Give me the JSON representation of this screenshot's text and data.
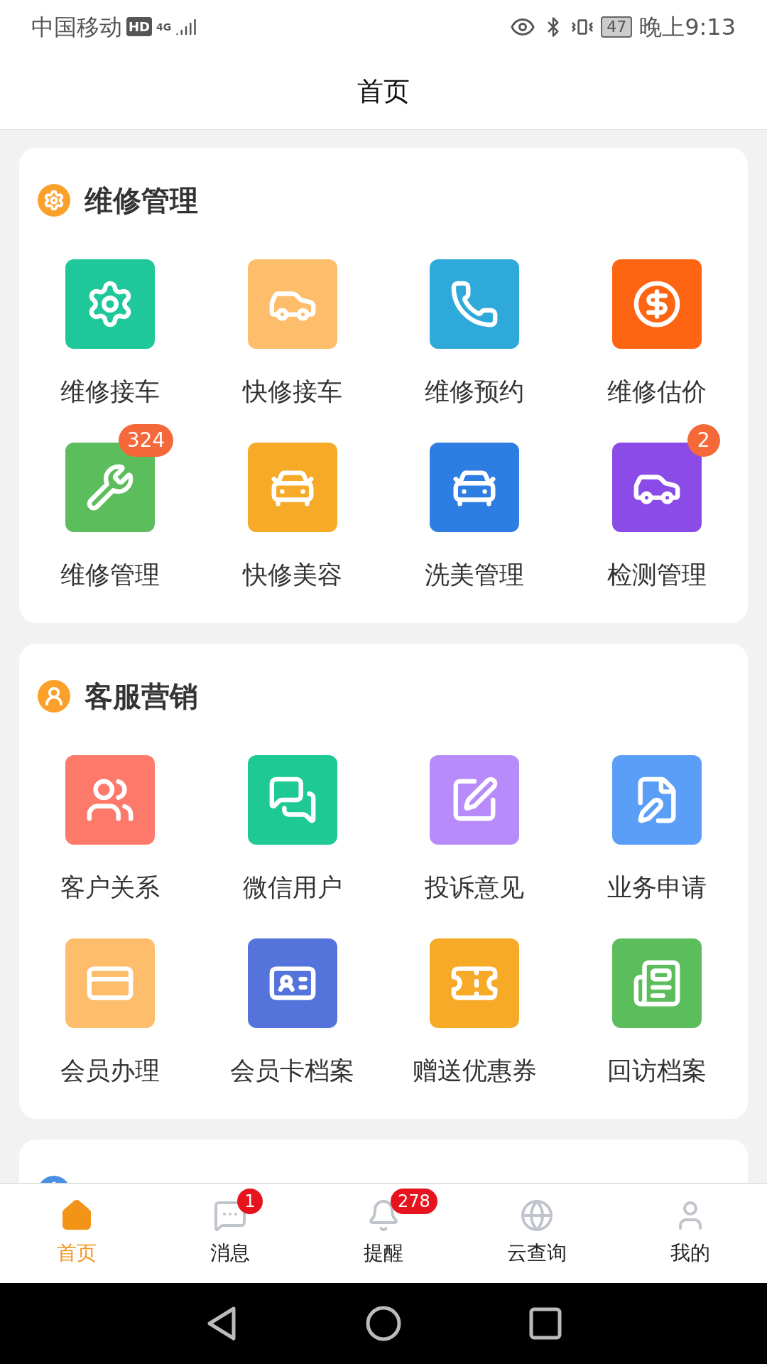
{
  "status_bar": {
    "carrier": "中国移动",
    "hd": "HD",
    "network": "4G",
    "battery": "47",
    "time": "晚上9:13"
  },
  "header": {
    "title": "首页"
  },
  "sections": [
    {
      "title": "维修管理",
      "color": "#fba02a",
      "items": [
        {
          "label": "维修接车",
          "color": "#1ec89a"
        },
        {
          "label": "快修接车",
          "color": "#fdbd6a"
        },
        {
          "label": "维修预约",
          "color": "#2fa9d9"
        },
        {
          "label": "维修估价",
          "color": "#fe6512"
        },
        {
          "label": "维修管理",
          "color": "#5cbd5c",
          "badge": "324"
        },
        {
          "label": "快修美容",
          "color": "#f7a928"
        },
        {
          "label": "洗美管理",
          "color": "#2e7de2"
        },
        {
          "label": "检测管理",
          "color": "#8a4be6",
          "badge": "2"
        }
      ]
    },
    {
      "title": "客服营销",
      "color": "#fba02a",
      "items": [
        {
          "label": "客户关系",
          "color": "#fd7a6b"
        },
        {
          "label": "微信用户",
          "color": "#1ec993"
        },
        {
          "label": "投诉意见",
          "color": "#b88bfa"
        },
        {
          "label": "业务申请",
          "color": "#5b9ef7"
        },
        {
          "label": "会员办理",
          "color": "#fdbd6a"
        },
        {
          "label": "会员卡档案",
          "color": "#5574db"
        },
        {
          "label": "赠送优惠券",
          "color": "#f7a928"
        },
        {
          "label": "回访档案",
          "color": "#5cbd5c"
        }
      ]
    },
    {
      "color": "#4a90e2"
    }
  ],
  "nav": [
    {
      "label": "首页",
      "selected": true
    },
    {
      "label": "消息",
      "selected": false,
      "badge": "1"
    },
    {
      "label": "提醒",
      "selected": false,
      "badge": "278"
    },
    {
      "label": "云查询",
      "selected": false
    },
    {
      "label": "我的",
      "selected": false
    }
  ]
}
